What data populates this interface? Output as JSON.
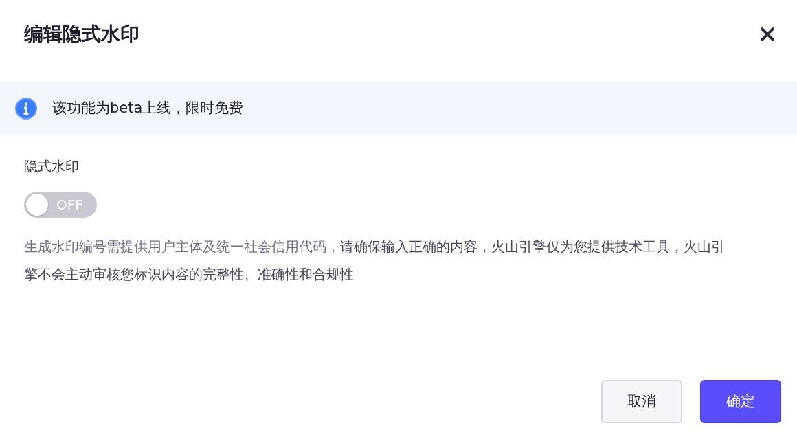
{
  "dialog": {
    "title": "编辑隐式水印"
  },
  "notice": {
    "text": "该功能为beta上线，限时免费"
  },
  "field": {
    "label": "隐式水印",
    "switch": {
      "on": false,
      "text": "OFF"
    },
    "help": "生成水印编号需提供用户主体及统一社会信用代码，**请确保输入正确的内容，火山引擎仅为您提供技术工具，火山引擎不会主动审核您标识内容的完整性、准确性和合规性**"
  },
  "buttons": [
    {
      "label": "取消",
      "kind": "secondary"
    },
    {
      "label": "确定",
      "kind": "primary"
    }
  ]
}
